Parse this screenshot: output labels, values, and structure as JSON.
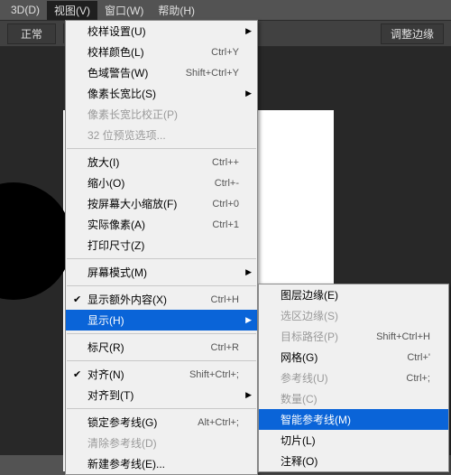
{
  "menubar": {
    "items": [
      {
        "label": "3D(D)"
      },
      {
        "label": "视图(V)"
      },
      {
        "label": "窗口(W)"
      },
      {
        "label": "帮助(H)"
      }
    ]
  },
  "toolbar": {
    "mode": "正常",
    "refine": "调整边缘"
  },
  "menu_main": [
    {
      "type": "item",
      "label": "校样设置(U)",
      "shortcut": "",
      "arrow": true
    },
    {
      "type": "item",
      "label": "校样颜色(L)",
      "shortcut": "Ctrl+Y"
    },
    {
      "type": "item",
      "label": "色域警告(W)",
      "shortcut": "Shift+Ctrl+Y"
    },
    {
      "type": "item",
      "label": "像素长宽比(S)",
      "shortcut": "",
      "arrow": true
    },
    {
      "type": "item",
      "label": "像素长宽比校正(P)",
      "disabled": true
    },
    {
      "type": "item",
      "label": "32 位预览选项...",
      "disabled": true
    },
    {
      "type": "sep"
    },
    {
      "type": "item",
      "label": "放大(I)",
      "shortcut": "Ctrl++"
    },
    {
      "type": "item",
      "label": "缩小(O)",
      "shortcut": "Ctrl+-"
    },
    {
      "type": "item",
      "label": "按屏幕大小缩放(F)",
      "shortcut": "Ctrl+0"
    },
    {
      "type": "item",
      "label": "实际像素(A)",
      "shortcut": "Ctrl+1"
    },
    {
      "type": "item",
      "label": "打印尺寸(Z)"
    },
    {
      "type": "sep"
    },
    {
      "type": "item",
      "label": "屏幕模式(M)",
      "arrow": true
    },
    {
      "type": "sep"
    },
    {
      "type": "item",
      "label": "显示额外内容(X)",
      "shortcut": "Ctrl+H",
      "checked": true
    },
    {
      "type": "item",
      "label": "显示(H)",
      "arrow": true,
      "highlight": true
    },
    {
      "type": "sep"
    },
    {
      "type": "item",
      "label": "标尺(R)",
      "shortcut": "Ctrl+R"
    },
    {
      "type": "sep"
    },
    {
      "type": "item",
      "label": "对齐(N)",
      "shortcut": "Shift+Ctrl+;",
      "checked": true
    },
    {
      "type": "item",
      "label": "对齐到(T)",
      "arrow": true
    },
    {
      "type": "sep"
    },
    {
      "type": "item",
      "label": "锁定参考线(G)",
      "shortcut": "Alt+Ctrl+;"
    },
    {
      "type": "item",
      "label": "清除参考线(D)",
      "disabled": true
    },
    {
      "type": "item",
      "label": "新建参考线(E)..."
    }
  ],
  "menu_sub": [
    {
      "type": "item",
      "label": "图层边缘(E)"
    },
    {
      "type": "item",
      "label": "选区边缘(S)",
      "disabled": true
    },
    {
      "type": "item",
      "label": "目标路径(P)",
      "shortcut": "Shift+Ctrl+H",
      "disabled": true
    },
    {
      "type": "item",
      "label": "网格(G)",
      "shortcut": "Ctrl+'"
    },
    {
      "type": "item",
      "label": "参考线(U)",
      "shortcut": "Ctrl+;",
      "disabled": true
    },
    {
      "type": "item",
      "label": "数量(C)",
      "disabled": true
    },
    {
      "type": "item",
      "label": "智能参考线(M)",
      "highlight": true
    },
    {
      "type": "item",
      "label": "切片(L)"
    },
    {
      "type": "item",
      "label": "注释(O)"
    }
  ]
}
